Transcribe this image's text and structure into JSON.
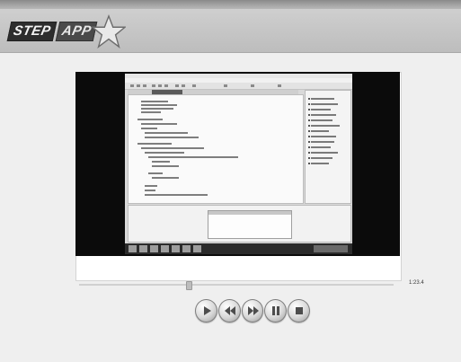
{
  "app": {
    "logo_part1": "STEP",
    "logo_part2": "APP"
  },
  "player": {
    "time_display": "1:23.4",
    "progress": 0.35,
    "controls": [
      {
        "id": "play",
        "icon": "play-icon"
      },
      {
        "id": "rewind",
        "icon": "rewind-icon"
      },
      {
        "id": "forward",
        "icon": "fast-forward-icon"
      },
      {
        "id": "pause",
        "icon": "pause-icon"
      },
      {
        "id": "stop",
        "icon": "stop-icon"
      }
    ]
  },
  "colors": {
    "header": "#c8c8c8",
    "background": "#eeeeee",
    "video_letterbox": "#0b0b0b"
  }
}
